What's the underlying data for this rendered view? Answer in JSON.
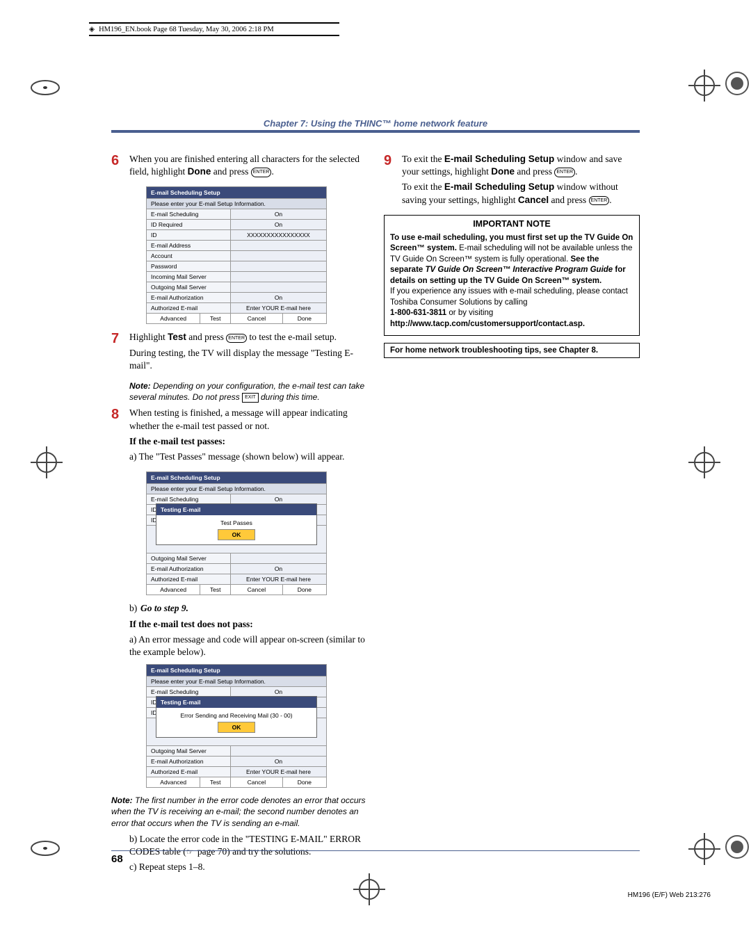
{
  "meta_line": "HM196_EN.book  Page 68  Tuesday, May 30, 2006  2:18 PM",
  "chapter_title": "Chapter 7: Using the THINC™ home network feature",
  "steps_left": {
    "s6": {
      "num": "6",
      "text_a": "When you are finished entering all characters for the selected field, highlight ",
      "done": "Done",
      "text_b": " and press ",
      "enter": "ENTER",
      "dot": "."
    },
    "setup_table_1": {
      "header": "E-mail Scheduling Setup",
      "subheader": "Please enter your E-mail Setup Information.",
      "rows": [
        {
          "label": "E-mail Scheduling",
          "value": "On"
        },
        {
          "label": "ID Required",
          "value": "On"
        },
        {
          "label": "ID",
          "value": "XXXXXXXXXXXXXXXX"
        },
        {
          "label": "E-mail Address",
          "value": ""
        },
        {
          "label": "Account",
          "value": ""
        },
        {
          "label": "Password",
          "value": ""
        },
        {
          "label": "Incoming Mail Server",
          "value": ""
        },
        {
          "label": "Outgoing Mail Server",
          "value": ""
        },
        {
          "label": "E-mail Authorization",
          "value": "On"
        },
        {
          "label": "Authorized E-mail",
          "value": "Enter YOUR E-mail here"
        }
      ],
      "buttons": [
        "Advanced",
        "Test",
        "Cancel",
        "Done"
      ]
    },
    "s7": {
      "num": "7",
      "text_a": "Highlight ",
      "test": "Test",
      "text_b": " and press ",
      "enter": "ENTER",
      "text_c": " to test the e-mail setup.",
      "text_d": "During testing, the TV will display the message \"Testing E-mail\"."
    },
    "note1": {
      "label": "Note:",
      "text_a": " Depending on your configuration, the e-mail test can take several minutes. Do not press ",
      "exit": "EXIT",
      "text_b": " during this time."
    },
    "s8": {
      "num": "8",
      "text_a": "When testing is finished, a message will appear indicating whether the e-mail test passed or not.",
      "pass_hdr": "If the e-mail test passes:",
      "a_line": "a) The \"Test Passes\" message (shown below) will appear."
    },
    "modal_pass": {
      "title": "Testing E-mail",
      "msg": "Test Passes",
      "ok": "OK"
    },
    "b_goto": "Go to step 9.",
    "fail_hdr": "If the e-mail test does not pass:",
    "fail_a": "a) An error message and code will appear on-screen (similar to the example below).",
    "modal_fail": {
      "title": "Testing E-mail",
      "msg": "Error Sending and Receiving Mail (30 - 00)",
      "ok": "OK"
    },
    "note2": {
      "label": "Note:",
      "text": " The first number in the error code denotes an error that occurs when the TV is receiving an e-mail; the second number denotes an error that occurs when the TV is sending an e-mail."
    },
    "fail_b_a": "b) Locate the error code in the \"TESTING E-MAIL\" ERROR CODES table (",
    "fail_b_icon": "☞",
    "fail_b_b": " page 70) and try the solutions.",
    "fail_c": "c) Repeat steps 1–8."
  },
  "steps_right": {
    "s9": {
      "num": "9",
      "text_a": "To exit the ",
      "win": "E-mail Scheduling Setup",
      "text_b": " window and save your settings, highlight ",
      "done": "Done",
      "text_c": " and press ",
      "enter": "ENTER",
      "dot": ".",
      "text_d": "To exit the ",
      "win2": "E-mail Scheduling Setup",
      "text_e": " window without saving your settings, highlight ",
      "cancel": "Cancel",
      "text_f": " and press ",
      "enter2": "ENTER",
      "dot2": "."
    },
    "important": {
      "title": "IMPORTANT NOTE",
      "p1_a": "To use e-mail scheduling, you must first set up the TV Guide On Screen™ system.",
      "p1_b": " E-mail scheduling will not be available unless the TV Guide On Screen™ system is fully operational. ",
      "p1_c": "See the separate ",
      "p1_guide": "TV Guide On Screen™ Interactive Program Guide",
      "p1_d": " for details on setting up the TV Guide On Screen™ system.",
      "p2": "If you experience any issues with e-mail scheduling, please contact Toshiba Consumer Solutions by calling",
      "phone": "1-800-631-3811",
      "p2b": " or by visiting",
      "url": "http://www.tacp.com/customersupport/contact.asp."
    },
    "troubleshoot": "For home network troubleshooting tips, see Chapter 8."
  },
  "page_number": "68",
  "footer_code": "HM196 (E/F) Web 213:276"
}
